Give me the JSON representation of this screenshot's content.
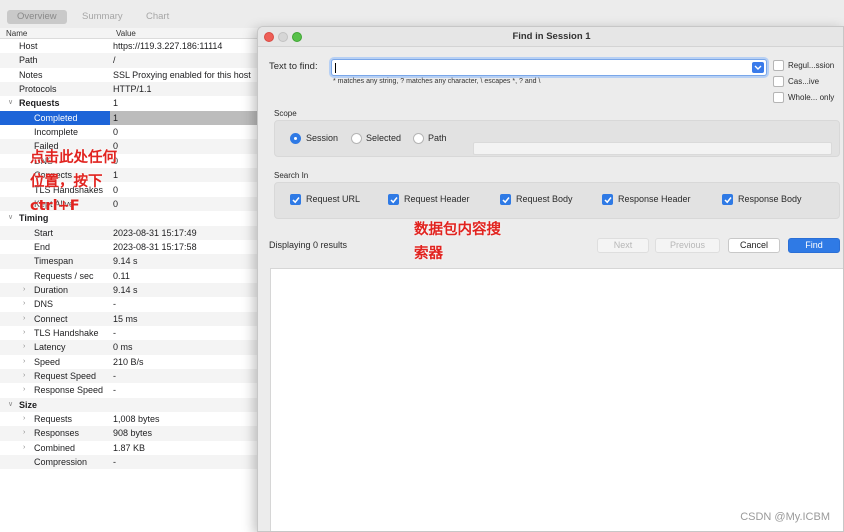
{
  "tabs": [
    "Overview",
    "Summary",
    "Chart"
  ],
  "columns": {
    "name": "Name",
    "value": "Value"
  },
  "rows": [
    {
      "name": "Host",
      "value": "https://119.3.227.186:11114",
      "indent": 1
    },
    {
      "name": "Path",
      "value": "/",
      "indent": 1
    },
    {
      "name": "Notes",
      "value": "SSL Proxying enabled for this host",
      "indent": 1
    },
    {
      "name": "Protocols",
      "value": "HTTP/1.1",
      "indent": 1
    },
    {
      "name": "Requests",
      "value": "1",
      "indent": 1,
      "caret": "expanded",
      "bold": true
    },
    {
      "name": "Completed",
      "value": "1",
      "indent": 2,
      "selected": true
    },
    {
      "name": "Incomplete",
      "value": "0",
      "indent": 2
    },
    {
      "name": "Failed",
      "value": "0",
      "indent": 2
    },
    {
      "name": "DNS",
      "value": "0",
      "indent": 2
    },
    {
      "name": "Connects",
      "value": "1",
      "indent": 2
    },
    {
      "name": "TLS Handshakes",
      "value": "0",
      "indent": 2
    },
    {
      "name": "Kept Alive",
      "value": "0",
      "indent": 2
    },
    {
      "name": "Timing",
      "value": "",
      "indent": 1,
      "caret": "expanded",
      "bold": true
    },
    {
      "name": "Start",
      "value": "2023-08-31 15:17:49",
      "indent": 2
    },
    {
      "name": "End",
      "value": "2023-08-31 15:17:58",
      "indent": 2
    },
    {
      "name": "Timespan",
      "value": "9.14 s",
      "indent": 2
    },
    {
      "name": "Requests / sec",
      "value": "0.11",
      "indent": 2
    },
    {
      "name": "Duration",
      "value": "9.14 s",
      "indent": 2,
      "caret": "collapsed"
    },
    {
      "name": "DNS",
      "value": "-",
      "indent": 2,
      "caret": "collapsed"
    },
    {
      "name": "Connect",
      "value": "15 ms",
      "indent": 2,
      "caret": "collapsed"
    },
    {
      "name": "TLS Handshake",
      "value": "-",
      "indent": 2,
      "caret": "collapsed"
    },
    {
      "name": "Latency",
      "value": "0 ms",
      "indent": 2,
      "caret": "collapsed"
    },
    {
      "name": "Speed",
      "value": "210 B/s",
      "indent": 2,
      "caret": "collapsed"
    },
    {
      "name": "Request Speed",
      "value": "-",
      "indent": 2,
      "caret": "collapsed"
    },
    {
      "name": "Response Speed",
      "value": "-",
      "indent": 2,
      "caret": "collapsed"
    },
    {
      "name": "Size",
      "value": "",
      "indent": 1,
      "caret": "expanded",
      "bold": true
    },
    {
      "name": "Requests",
      "value": "1,008 bytes",
      "indent": 2,
      "caret": "collapsed"
    },
    {
      "name": "Responses",
      "value": "908 bytes",
      "indent": 2,
      "caret": "collapsed"
    },
    {
      "name": "Combined",
      "value": "1.87 KB",
      "indent": 2,
      "caret": "collapsed"
    },
    {
      "name": "Compression",
      "value": "-",
      "indent": 2
    }
  ],
  "dialog": {
    "title": "Find in Session 1",
    "text_to_find_label": "Text to find:",
    "text_to_find_value": "",
    "hint": "* matches any string, ? matches any character, \\ escapes *, ? and \\",
    "options": [
      {
        "label": "Regul...ssion",
        "checked": false
      },
      {
        "label": "Cas...ive",
        "checked": false
      },
      {
        "label": "Whole... only",
        "checked": false
      }
    ],
    "scope_label": "Scope",
    "scope_options": [
      {
        "label": "Session",
        "selected": true
      },
      {
        "label": "Selected",
        "selected": false
      },
      {
        "label": "Path",
        "selected": false
      }
    ],
    "search_in_label": "Search In",
    "search_in": [
      {
        "label": "Request URL",
        "checked": true
      },
      {
        "label": "Request Header",
        "checked": true
      },
      {
        "label": "Request Body",
        "checked": true
      },
      {
        "label": "Response Header",
        "checked": true
      },
      {
        "label": "Response Body",
        "checked": true
      }
    ],
    "status": "Displaying 0 results",
    "buttons": {
      "next": "Next",
      "previous": "Previous",
      "cancel": "Cancel",
      "find": "Find"
    }
  },
  "annotations": {
    "left": "点击此处任何\n位置，按下\nctrl+F",
    "right": "数据包内容搜\n索器"
  },
  "watermark": "CSDN @My.ICBM",
  "colors": {
    "accent": "#2f7ae5",
    "selection": "#1d64d8",
    "annotation": "#e1231f"
  }
}
